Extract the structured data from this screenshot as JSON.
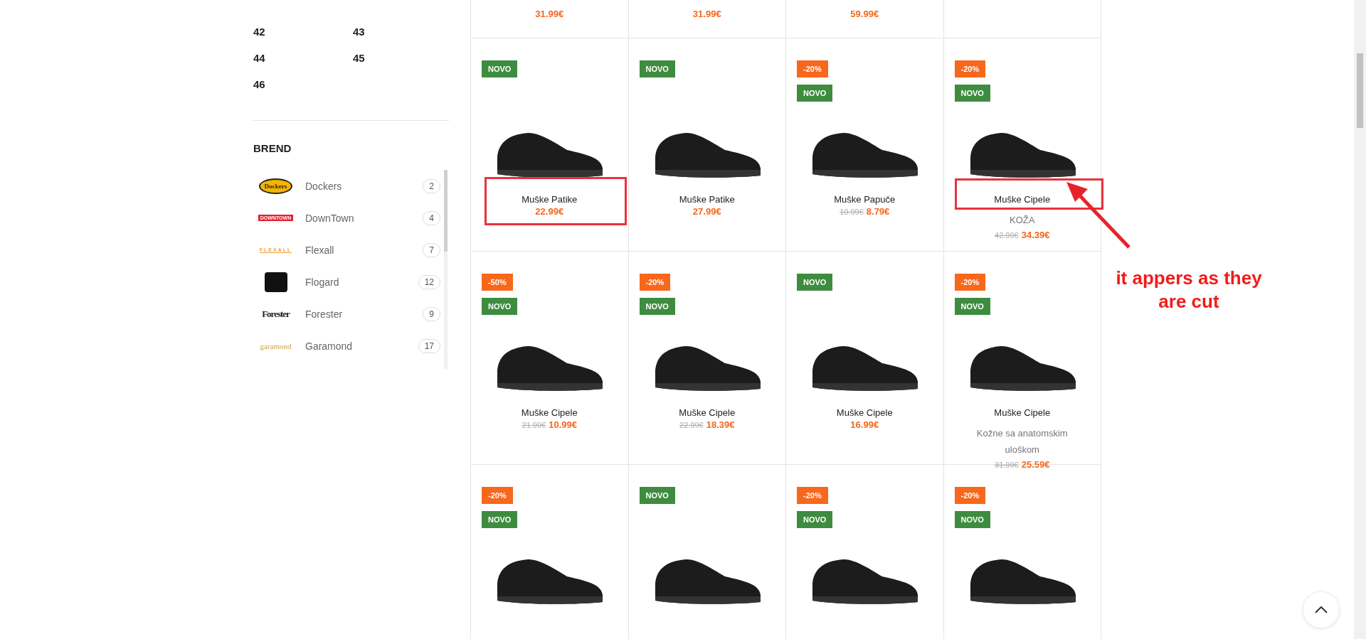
{
  "sidebar": {
    "sizes": [
      "42",
      "43",
      "44",
      "45",
      "46"
    ],
    "brand_heading": "BREND",
    "brands": [
      {
        "kind": "dockers",
        "logo": "Dockers",
        "name": "Dockers",
        "count": "2"
      },
      {
        "kind": "downtown",
        "logo": "DOWNTOWN",
        "name": "DownTown",
        "count": "4"
      },
      {
        "kind": "flexall",
        "logo": "FLEXALL",
        "name": "Flexall",
        "count": "7"
      },
      {
        "kind": "flogard",
        "name": "Flogard",
        "count": "12"
      },
      {
        "kind": "forester",
        "logo": "Forester",
        "name": "Forester",
        "count": "9"
      },
      {
        "kind": "garamond",
        "logo": "garamond",
        "name": "Garamond",
        "count": "17"
      }
    ]
  },
  "products": [
    {
      "kind": "tail",
      "price": "31.99€"
    },
    {
      "kind": "tail",
      "price": "31.99€"
    },
    {
      "kind": "tail",
      "price": "59.99€"
    },
    {
      "kind": "tail"
    },
    {
      "kind": "full",
      "badges": [
        {
          "kind": "novo",
          "text": "NOVO"
        }
      ],
      "title": "Muške Patike",
      "price": "22.99€"
    },
    {
      "kind": "full",
      "badges": [
        {
          "kind": "novo",
          "text": "NOVO"
        }
      ],
      "title": "Muške Patike",
      "price": "27.99€"
    },
    {
      "kind": "full",
      "badges": [
        {
          "kind": "sale",
          "text": "-20%"
        },
        {
          "kind": "novo",
          "text": "NOVO"
        }
      ],
      "title": "Muške Papuče",
      "old_price": "10.99€",
      "price": "8.79€"
    },
    {
      "kind": "full",
      "badges": [
        {
          "kind": "sale",
          "text": "-20%"
        },
        {
          "kind": "novo",
          "text": "NOVO"
        }
      ],
      "title": "Muške Cipele",
      "subtitle": "KOŽA",
      "old_price": "42.99€",
      "price": "34.39€"
    },
    {
      "kind": "full",
      "badges": [
        {
          "kind": "sale",
          "text": "-50%"
        },
        {
          "kind": "novo",
          "text": "NOVO"
        }
      ],
      "title": "Muške Cipele",
      "old_price": "21.99€",
      "price": "10.99€"
    },
    {
      "kind": "full",
      "badges": [
        {
          "kind": "sale",
          "text": "-20%"
        },
        {
          "kind": "novo",
          "text": "NOVO"
        }
      ],
      "title": "Muške Cipele",
      "old_price": "22.99€",
      "price": "18.39€"
    },
    {
      "kind": "full",
      "badges": [
        {
          "kind": "novo",
          "text": "NOVO"
        }
      ],
      "title": "Muške Cipele",
      "price": "16.99€"
    },
    {
      "kind": "full",
      "badges": [
        {
          "kind": "sale",
          "text": "-20%"
        },
        {
          "kind": "novo",
          "text": "NOVO"
        }
      ],
      "title": "Muške Cipele",
      "subtitle": "Kožne sa anatomskim uloškom",
      "old_price": "31.99€",
      "price": "25.59€"
    },
    {
      "kind": "full",
      "badges": [
        {
          "kind": "sale",
          "text": "-20%"
        },
        {
          "kind": "novo",
          "text": "NOVO"
        }
      ]
    },
    {
      "kind": "full",
      "badges": [
        {
          "kind": "novo",
          "text": "NOVO"
        }
      ]
    },
    {
      "kind": "full",
      "badges": [
        {
          "kind": "sale",
          "text": "-20%"
        },
        {
          "kind": "novo",
          "text": "NOVO"
        }
      ]
    },
    {
      "kind": "full",
      "badges": [
        {
          "kind": "sale",
          "text": "-20%"
        },
        {
          "kind": "novo",
          "text": "NOVO"
        }
      ]
    }
  ],
  "annotation": {
    "text": "it appers as they are cut"
  }
}
